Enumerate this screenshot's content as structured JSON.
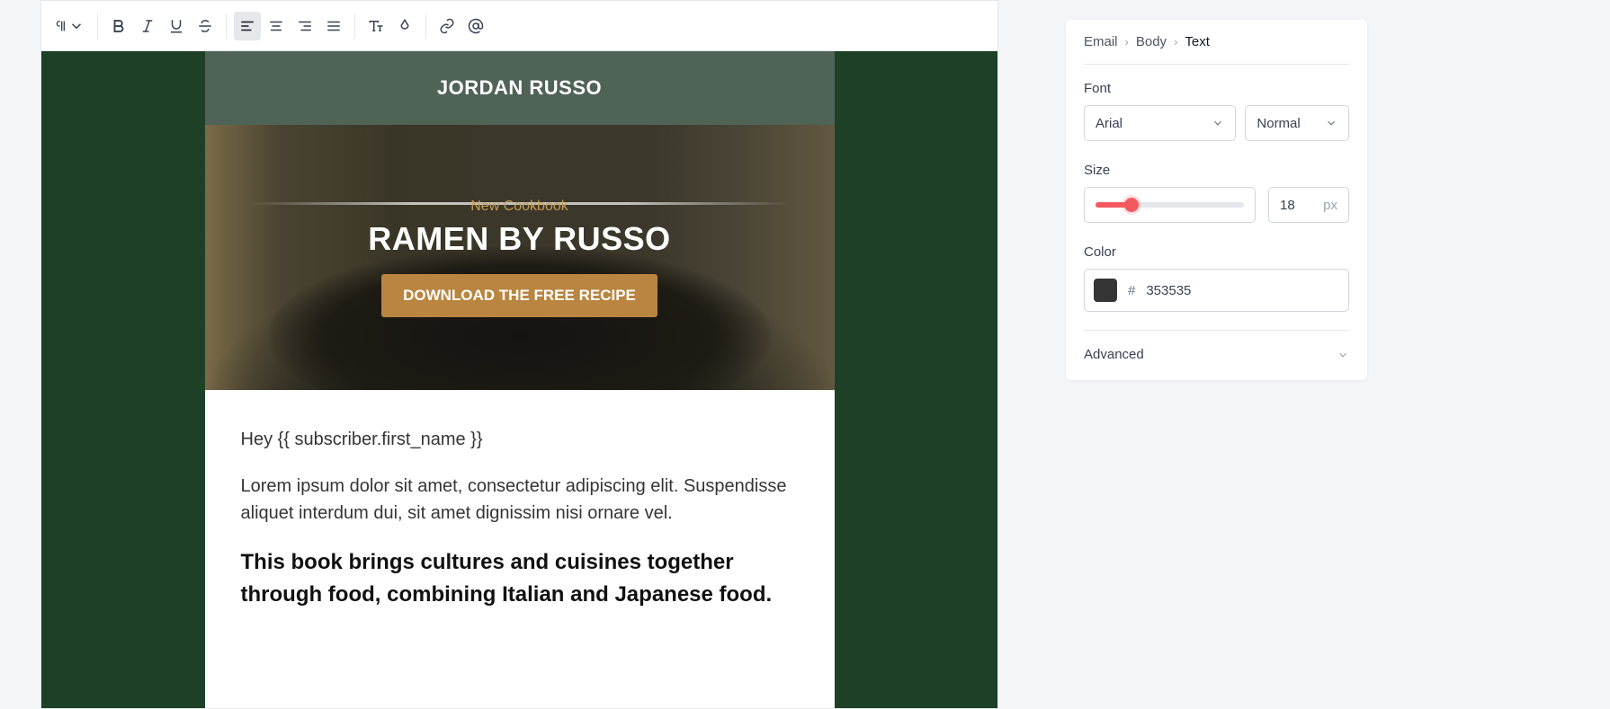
{
  "breadcrumb": {
    "email": "Email",
    "body": "Body",
    "text": "Text"
  },
  "panel": {
    "font_label": "Font",
    "font_family": "Arial",
    "font_weight": "Normal",
    "size_label": "Size",
    "size_value": "18",
    "size_unit": "px",
    "color_label": "Color",
    "color_hash": "#",
    "color_value": "353535",
    "advanced": "Advanced"
  },
  "email": {
    "brand": "JORDAN RUSSO",
    "eyebrow": "New Cookbook",
    "hero_title": "RAMEN BY RUSSO",
    "cta": "DOWNLOAD THE FREE RECIPE",
    "greeting": "Hey {{ subscriber.first_name }}",
    "para1": "Lorem ipsum dolor sit amet, consectetur adipiscing elit. Suspendisse aliquet interdum dui, sit amet dignissim nisi ornare vel.",
    "para2": "This book brings cultures and cuisines together through food, combining Italian and Japanese food."
  }
}
